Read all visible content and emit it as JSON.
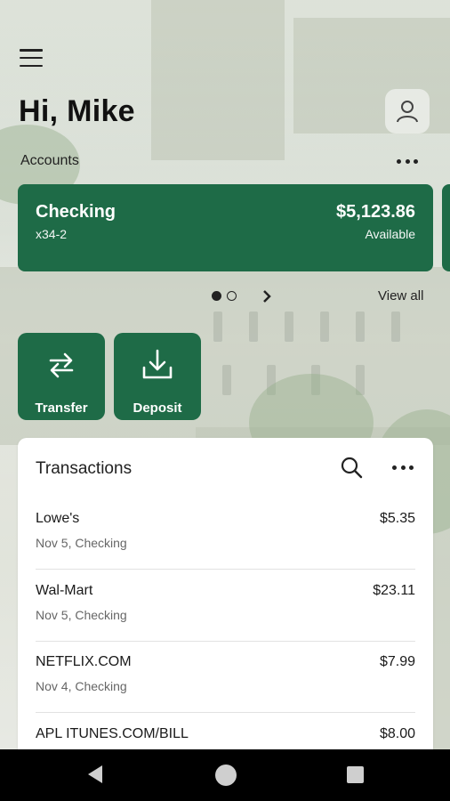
{
  "header": {
    "greeting": "Hi, Mike",
    "menu_icon": "hamburger-menu-icon",
    "profile_icon": "user-profile-icon"
  },
  "accounts": {
    "section_label": "Accounts",
    "more_icon": "more-horizontal-icon",
    "cards": [
      {
        "name": "Checking",
        "number": "x34-2",
        "balance": "$5,123.86",
        "balance_label": "Available"
      }
    ],
    "pager": {
      "total": 2,
      "active_index": 0
    },
    "view_all_label": "View all"
  },
  "actions": [
    {
      "label": "Transfer",
      "icon": "transfer-arrows-icon"
    },
    {
      "label": "Deposit",
      "icon": "download-tray-icon"
    }
  ],
  "transactions": {
    "title": "Transactions",
    "search_icon": "search-icon",
    "more_icon": "more-horizontal-icon",
    "items": [
      {
        "merchant": "Lowe's",
        "meta": "Nov 5, Checking",
        "amount": "$5.35"
      },
      {
        "merchant": "Wal-Mart",
        "meta": "Nov 5, Checking",
        "amount": "$23.11"
      },
      {
        "merchant": "NETFLIX.COM",
        "meta": "Nov 4, Checking",
        "amount": "$7.99"
      },
      {
        "merchant": "APL ITUNES.COM/BILL",
        "meta": "",
        "amount": "$8.00"
      }
    ]
  },
  "system_nav": {
    "back": "back-triangle-icon",
    "home": "home-circle-icon",
    "recents": "recents-square-icon"
  },
  "colors": {
    "brand_green": "#1e6b47",
    "text_dark": "#1a1a1a",
    "text_muted": "#666666"
  }
}
